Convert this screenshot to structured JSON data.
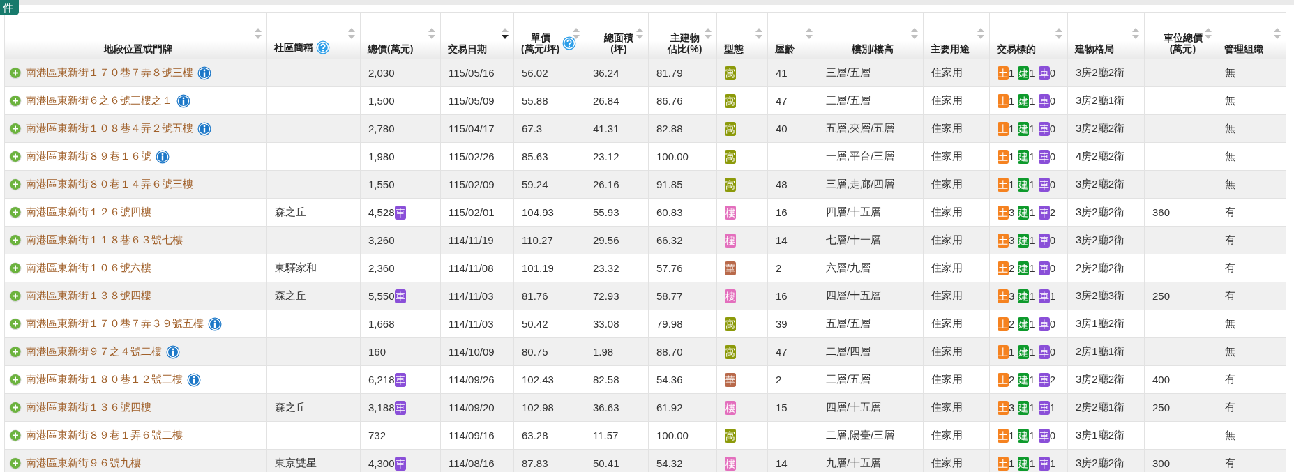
{
  "top_tab": {
    "label": "件"
  },
  "columns": [
    {
      "lines": [
        "地段位置或門牌"
      ],
      "sorted": false,
      "centered": true,
      "help": false
    },
    {
      "lines": [
        "社區簡稱"
      ],
      "sorted": false,
      "centered": false,
      "help": true
    },
    {
      "lines": [
        "總價(萬元)"
      ],
      "sorted": false,
      "centered": false,
      "help": false
    },
    {
      "lines": [
        "交易日期"
      ],
      "sorted": true,
      "centered": false,
      "help": false
    },
    {
      "lines": [
        "單價",
        "(萬元/坪)"
      ],
      "sorted": false,
      "centered": false,
      "help": true
    },
    {
      "lines": [
        "總面積",
        "(坪)"
      ],
      "sorted": false,
      "centered": true,
      "help": false
    },
    {
      "lines": [
        "主建物",
        "佔比(%)"
      ],
      "sorted": false,
      "centered": true,
      "help": false
    },
    {
      "lines": [
        "型態"
      ],
      "sorted": false,
      "centered": false,
      "help": false
    },
    {
      "lines": [
        "屋齡"
      ],
      "sorted": false,
      "centered": false,
      "help": false
    },
    {
      "lines": [
        "樓別/樓高"
      ],
      "sorted": false,
      "centered": true,
      "help": false
    },
    {
      "lines": [
        "主要用途"
      ],
      "sorted": false,
      "centered": false,
      "help": false
    },
    {
      "lines": [
        "交易標的"
      ],
      "sorted": false,
      "centered": false,
      "help": false
    },
    {
      "lines": [
        "建物格局"
      ],
      "sorted": false,
      "centered": false,
      "help": false
    },
    {
      "lines": [
        "車位總價",
        "(萬元)"
      ],
      "sorted": false,
      "centered": true,
      "help": false
    },
    {
      "lines": [
        "管理組織"
      ],
      "sorted": false,
      "centered": false,
      "help": false
    }
  ],
  "rows": [
    {
      "address": "南港區東新街１７０巷７弄８號三樓",
      "info": true,
      "price": "2,030",
      "date": "115/05/16",
      "unit_price": "56.02",
      "area": "36.24",
      "ratio": "81.79",
      "type": {
        "label": "寓",
        "color": "#8c9a0a"
      },
      "age": "41",
      "floor": "三層/五層",
      "use": "住家用",
      "target": [
        {
          "label": "土",
          "count": "1",
          "color": "#f58220"
        },
        {
          "label": "建",
          "count": "1",
          "color": "#0e9a2c"
        },
        {
          "label": "車",
          "count": "0",
          "color": "#8a4fd8"
        }
      ],
      "layout": "3房2廳2衛",
      "management": "無"
    },
    {
      "address": "南港區東新街６之６號三樓之１",
      "info": true,
      "price": "1,500",
      "date": "115/05/09",
      "unit_price": "55.88",
      "area": "26.84",
      "ratio": "86.76",
      "type": {
        "label": "寓",
        "color": "#8c9a0a"
      },
      "age": "47",
      "floor": "三層/五層",
      "use": "住家用",
      "target": [
        {
          "label": "土",
          "count": "1",
          "color": "#f58220"
        },
        {
          "label": "建",
          "count": "1",
          "color": "#0e9a2c"
        },
        {
          "label": "車",
          "count": "0",
          "color": "#8a4fd8"
        }
      ],
      "layout": "3房2廳1衛",
      "management": "無"
    },
    {
      "address": "南港區東新街１０８巷４弄２號五樓",
      "info": true,
      "price": "2,780",
      "date": "115/04/17",
      "unit_price": "67.3",
      "area": "41.31",
      "ratio": "82.88",
      "type": {
        "label": "寓",
        "color": "#8c9a0a"
      },
      "age": "40",
      "floor": "五層,夾層/五層",
      "use": "住家用",
      "target": [
        {
          "label": "土",
          "count": "1",
          "color": "#f58220"
        },
        {
          "label": "建",
          "count": "1",
          "color": "#0e9a2c"
        },
        {
          "label": "車",
          "count": "0",
          "color": "#8a4fd8"
        }
      ],
      "layout": "3房2廳2衛",
      "management": "無"
    },
    {
      "address": "南港區東新街８９巷１６號",
      "info": true,
      "price": "1,980",
      "date": "115/02/26",
      "unit_price": "85.63",
      "area": "23.12",
      "ratio": "100.00",
      "type": {
        "label": "寓",
        "color": "#8c9a0a"
      },
      "floor": "一層,平台/三層",
      "use": "住家用",
      "target": [
        {
          "label": "土",
          "count": "1",
          "color": "#f58220"
        },
        {
          "label": "建",
          "count": "1",
          "color": "#0e9a2c"
        },
        {
          "label": "車",
          "count": "0",
          "color": "#8a4fd8"
        }
      ],
      "layout": "4房2廳2衛",
      "management": "無"
    },
    {
      "address": "南港區東新街８０巷１４弄６號三樓",
      "info": false,
      "price": "1,550",
      "date": "115/02/09",
      "unit_price": "59.24",
      "area": "26.16",
      "ratio": "91.85",
      "type": {
        "label": "寓",
        "color": "#8c9a0a"
      },
      "age": "48",
      "floor": "三層,走廊/四層",
      "use": "住家用",
      "target": [
        {
          "label": "土",
          "count": "1",
          "color": "#f58220"
        },
        {
          "label": "建",
          "count": "1",
          "color": "#0e9a2c"
        },
        {
          "label": "車",
          "count": "0",
          "color": "#8a4fd8"
        }
      ],
      "layout": "3房2廳2衛",
      "management": "無"
    },
    {
      "address": "南港區東新街１２６號四樓",
      "info": false,
      "community": "森之丘",
      "price": "4,528",
      "parking_badge": "車",
      "date": "115/02/01",
      "unit_price": "104.93",
      "area": "55.93",
      "ratio": "60.83",
      "type": {
        "label": "樓",
        "color": "#e36fbd"
      },
      "age": "16",
      "floor": "四層/十五層",
      "use": "住家用",
      "target": [
        {
          "label": "土",
          "count": "3",
          "color": "#f58220"
        },
        {
          "label": "建",
          "count": "1",
          "color": "#0e9a2c"
        },
        {
          "label": "車",
          "count": "2",
          "color": "#8a4fd8"
        }
      ],
      "layout": "3房2廳2衛",
      "parking_price": "360",
      "management": "有"
    },
    {
      "address": "南港區東新街１１８巷６３號七樓",
      "info": false,
      "price": "3,260",
      "date": "114/11/19",
      "unit_price": "110.27",
      "area": "29.56",
      "ratio": "66.32",
      "type": {
        "label": "樓",
        "color": "#e36fbd"
      },
      "age": "14",
      "floor": "七層/十一層",
      "use": "住家用",
      "target": [
        {
          "label": "土",
          "count": "3",
          "color": "#f58220"
        },
        {
          "label": "建",
          "count": "1",
          "color": "#0e9a2c"
        },
        {
          "label": "車",
          "count": "0",
          "color": "#8a4fd8"
        }
      ],
      "layout": "3房2廳2衛",
      "management": "有"
    },
    {
      "address": "南港區東新街１０６號六樓",
      "info": false,
      "community": "東驛家和",
      "price": "2,360",
      "date": "114/11/08",
      "unit_price": "101.19",
      "area": "23.32",
      "ratio": "57.76",
      "type": {
        "label": "華",
        "color": "#b8694a"
      },
      "age": "2",
      "floor": "六層/九層",
      "use": "住家用",
      "target": [
        {
          "label": "土",
          "count": "2",
          "color": "#f58220"
        },
        {
          "label": "建",
          "count": "1",
          "color": "#0e9a2c"
        },
        {
          "label": "車",
          "count": "0",
          "color": "#8a4fd8"
        }
      ],
      "layout": "2房2廳2衛",
      "management": "有"
    },
    {
      "address": "南港區東新街１３８號四樓",
      "info": false,
      "community": "森之丘",
      "price": "5,550",
      "parking_badge": "車",
      "date": "114/11/03",
      "unit_price": "81.76",
      "area": "72.93",
      "ratio": "58.77",
      "type": {
        "label": "樓",
        "color": "#e36fbd"
      },
      "age": "16",
      "floor": "四層/十五層",
      "use": "住家用",
      "target": [
        {
          "label": "土",
          "count": "3",
          "color": "#f58220"
        },
        {
          "label": "建",
          "count": "1",
          "color": "#0e9a2c"
        },
        {
          "label": "車",
          "count": "1",
          "color": "#8a4fd8"
        }
      ],
      "layout": "3房2廳3衛",
      "parking_price": "250",
      "management": "有"
    },
    {
      "address": "南港區東新街１７０巷７弄３９號五樓",
      "info": true,
      "price": "1,668",
      "date": "114/11/03",
      "unit_price": "50.42",
      "area": "33.08",
      "ratio": "79.98",
      "type": {
        "label": "寓",
        "color": "#8c9a0a"
      },
      "age": "39",
      "floor": "五層/五層",
      "use": "住家用",
      "target": [
        {
          "label": "土",
          "count": "2",
          "color": "#f58220"
        },
        {
          "label": "建",
          "count": "1",
          "color": "#0e9a2c"
        },
        {
          "label": "車",
          "count": "0",
          "color": "#8a4fd8"
        }
      ],
      "layout": "3房1廳2衛",
      "management": "無"
    },
    {
      "address": "南港區東新街９７之４號二樓",
      "info": true,
      "price": "160",
      "date": "114/10/09",
      "unit_price": "80.75",
      "area": "1.98",
      "ratio": "88.70",
      "type": {
        "label": "寓",
        "color": "#8c9a0a"
      },
      "age": "47",
      "floor": "二層/四層",
      "use": "住家用",
      "target": [
        {
          "label": "土",
          "count": "1",
          "color": "#f58220"
        },
        {
          "label": "建",
          "count": "1",
          "color": "#0e9a2c"
        },
        {
          "label": "車",
          "count": "0",
          "color": "#8a4fd8"
        }
      ],
      "layout": "2房1廳1衛",
      "management": "無"
    },
    {
      "address": "南港區東新街１８０巷１２號三樓",
      "info": true,
      "price": "6,218",
      "parking_badge": "車",
      "date": "114/09/26",
      "unit_price": "102.43",
      "area": "82.58",
      "ratio": "54.36",
      "type": {
        "label": "華",
        "color": "#b8694a"
      },
      "age": "2",
      "floor": "三層/五層",
      "use": "住家用",
      "target": [
        {
          "label": "土",
          "count": "2",
          "color": "#f58220"
        },
        {
          "label": "建",
          "count": "1",
          "color": "#0e9a2c"
        },
        {
          "label": "車",
          "count": "2",
          "color": "#8a4fd8"
        }
      ],
      "layout": "3房2廳2衛",
      "parking_price": "400",
      "management": "有"
    },
    {
      "address": "南港區東新街１３６號四樓",
      "info": false,
      "community": "森之丘",
      "price": "3,188",
      "parking_badge": "車",
      "date": "114/09/20",
      "unit_price": "102.98",
      "area": "36.63",
      "ratio": "61.92",
      "type": {
        "label": "樓",
        "color": "#e36fbd"
      },
      "age": "15",
      "floor": "四層/十五層",
      "use": "住家用",
      "target": [
        {
          "label": "土",
          "count": "3",
          "color": "#f58220"
        },
        {
          "label": "建",
          "count": "1",
          "color": "#0e9a2c"
        },
        {
          "label": "車",
          "count": "1",
          "color": "#8a4fd8"
        }
      ],
      "layout": "2房2廳1衛",
      "parking_price": "250",
      "management": "有"
    },
    {
      "address": "南港區東新街８９巷１弄６號二樓",
      "info": false,
      "price": "732",
      "date": "114/09/16",
      "unit_price": "63.28",
      "area": "11.57",
      "ratio": "100.00",
      "type": {
        "label": "寓",
        "color": "#8c9a0a"
      },
      "floor": "二層,陽臺/三層",
      "use": "住家用",
      "target": [
        {
          "label": "土",
          "count": "1",
          "color": "#f58220"
        },
        {
          "label": "建",
          "count": "1",
          "color": "#0e9a2c"
        },
        {
          "label": "車",
          "count": "0",
          "color": "#8a4fd8"
        }
      ],
      "layout": "3房1廳2衛",
      "management": "無"
    },
    {
      "address": "南港區東新街９６號九樓",
      "info": false,
      "community": "東京雙星",
      "price": "4,300",
      "parking_badge": "車",
      "date": "114/08/16",
      "unit_price": "87.83",
      "area": "50.41",
      "ratio": "54.32",
      "type": {
        "label": "樓",
        "color": "#e36fbd"
      },
      "age": "14",
      "floor": "九層/十五層",
      "use": "住家用",
      "target": [
        {
          "label": "土",
          "count": "1",
          "color": "#f58220"
        },
        {
          "label": "建",
          "count": "1",
          "color": "#0e9a2c"
        },
        {
          "label": "車",
          "count": "1",
          "color": "#8a4fd8"
        }
      ],
      "layout": "3房2廳2衛",
      "parking_price": "300",
      "management": "有"
    }
  ]
}
